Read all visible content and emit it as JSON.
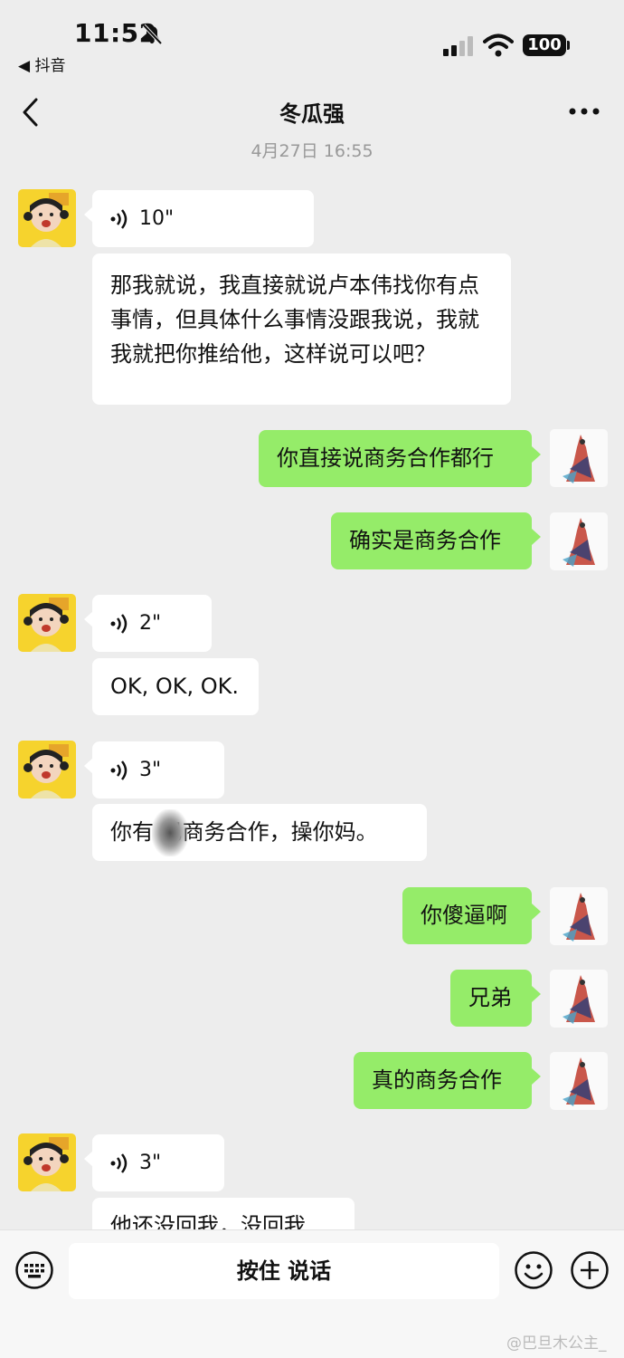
{
  "status_bar": {
    "time": "11:52",
    "back_app": "◀ 抖音",
    "battery": "100"
  },
  "header": {
    "title": "冬瓜强"
  },
  "timestamp": "4月27日 16:55",
  "messages": [
    {
      "side": "in",
      "type": "voice",
      "duration": "10\""
    },
    {
      "side": "in",
      "type": "text",
      "text": "那我就说，我直接就说卢本伟找你有点事情，但具体什么事情没跟我说，我就我就把你推给他，这样说可以吧？"
    },
    {
      "side": "out",
      "type": "text",
      "text": "你直接说商务合作都行"
    },
    {
      "side": "out",
      "type": "text",
      "text": "确实是商务合作"
    },
    {
      "side": "in",
      "type": "voice",
      "duration": "2\""
    },
    {
      "side": "in",
      "type": "text",
      "text": "OK, OK, OK."
    },
    {
      "side": "in",
      "type": "voice",
      "duration": "3\""
    },
    {
      "side": "in",
      "type": "text",
      "text": "你有  巴商务合作，操你妈。"
    },
    {
      "side": "out",
      "type": "text",
      "text": "你傻逼啊"
    },
    {
      "side": "out",
      "type": "text",
      "text": "兄弟"
    },
    {
      "side": "out",
      "type": "text",
      "text": "真的商务合作"
    },
    {
      "side": "in",
      "type": "voice",
      "duration": "3\""
    },
    {
      "side": "in",
      "type": "text",
      "text": "他还没回我，没回我"
    }
  ],
  "input_bar": {
    "hold_to_talk": "按住 说话"
  },
  "watermark": "@巴旦木公主_",
  "colors": {
    "background": "#ededed",
    "outgoing_bubble": "#95ec69",
    "incoming_bubble": "#ffffff"
  },
  "icons": [
    "bell-muted-icon",
    "signal-icon",
    "wifi-icon",
    "battery-icon",
    "back-chevron-icon",
    "more-dots-icon",
    "voice-wave-icon",
    "keyboard-icon",
    "emoji-icon",
    "plus-icon"
  ]
}
